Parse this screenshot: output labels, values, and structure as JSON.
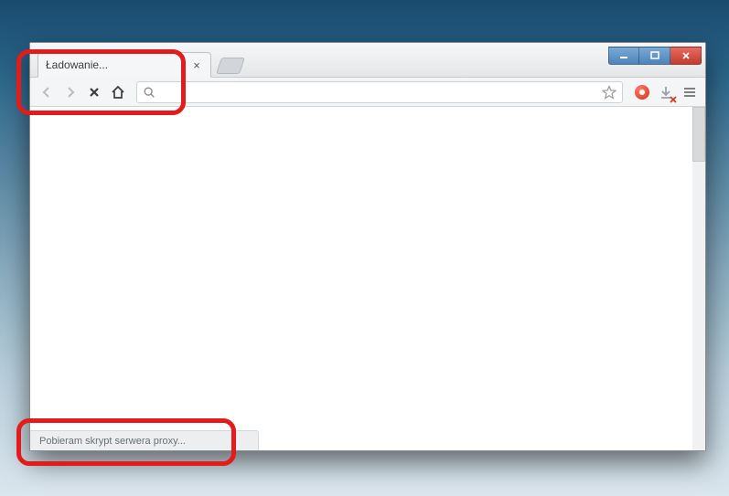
{
  "tab": {
    "title": "Ładowanie..."
  },
  "status": {
    "text": "Pobieram skrypt serwera proxy..."
  },
  "icons": {
    "back": "back-icon",
    "forward": "forward-icon",
    "stop": "stop-icon",
    "home": "home-icon",
    "search": "search-icon",
    "star": "star-icon",
    "adblock": "adblock-icon",
    "download": "download-icon",
    "menu": "hamburger-icon",
    "newtab": "new-tab-icon",
    "tabclose": "close-icon",
    "min": "minimize-icon",
    "max": "maximize-icon",
    "close": "window-close-icon"
  },
  "colors": {
    "annotation": "#e31b1b",
    "adblock": "#d6321a"
  }
}
